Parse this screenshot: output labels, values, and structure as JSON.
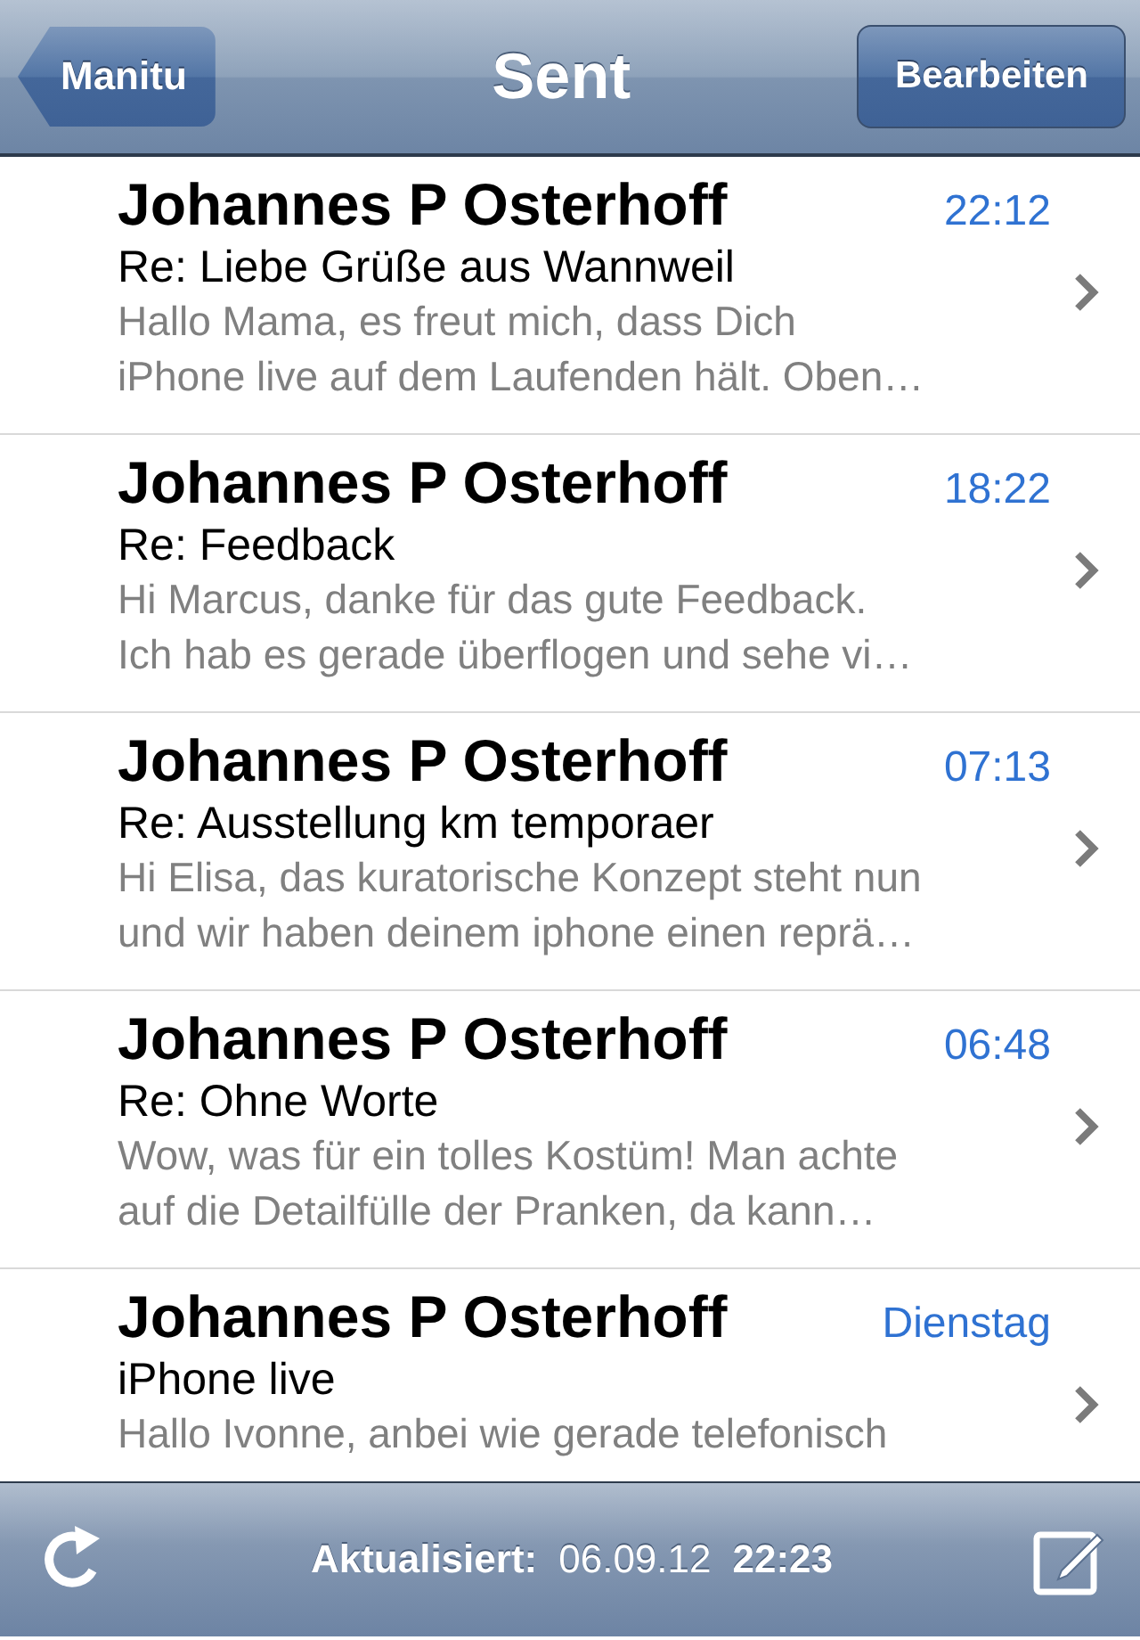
{
  "nav_bar": {
    "back_button": "Manitu",
    "title": "Sent",
    "edit_button": "Bearbeiten"
  },
  "messages": [
    {
      "sender": "Johannes P Osterhoff",
      "time": "22:12",
      "subject": "Re: Liebe Grüße aus Wannweil",
      "preview_lines": [
        "Hallo Mama, es freut mich, dass Dich",
        "iPhone live auf dem Laufenden hält. Oben…"
      ]
    },
    {
      "sender": "Johannes P Osterhoff",
      "time": "18:22",
      "subject": "Re: Feedback",
      "preview_lines": [
        "Hi Marcus, danke für das gute Feedback.",
        "Ich hab es gerade überflogen und sehe vi…"
      ]
    },
    {
      "sender": "Johannes P Osterhoff",
      "time": "07:13",
      "subject": "Re: Ausstellung km temporaer",
      "preview_lines": [
        "Hi Elisa, das kuratorische Konzept steht nun",
        "und wir haben deinem iphone einen reprä…"
      ]
    },
    {
      "sender": "Johannes P Osterhoff",
      "time": "06:48",
      "subject": "Re: Ohne Worte",
      "preview_lines": [
        "Wow, was für ein tolles Kostüm! Man achte",
        "auf die Detailfülle der Pranken, da kann…"
      ]
    },
    {
      "sender": "Johannes P Osterhoff",
      "time": "Dienstag",
      "subject": "iPhone live",
      "preview_lines": [
        "Hallo Ivonne, anbei wie gerade telefonisch"
      ]
    }
  ],
  "toolbar": {
    "updated_label": "Aktualisiert:",
    "date": "06.09.12",
    "time": "22:23"
  }
}
